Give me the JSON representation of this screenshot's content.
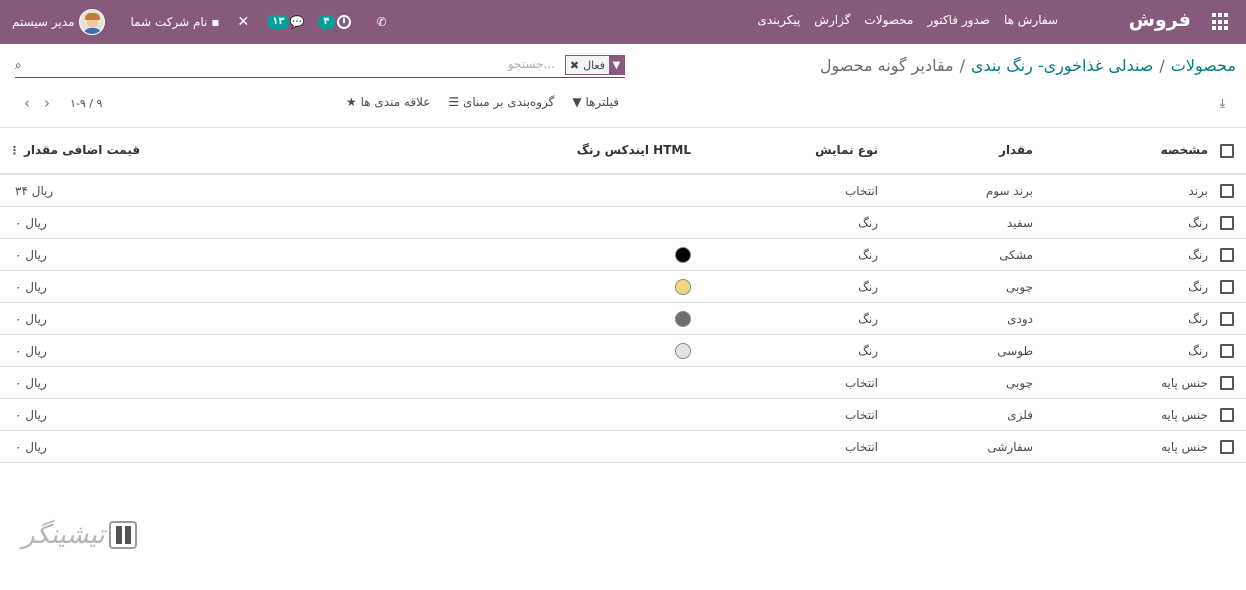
{
  "navbar": {
    "brand": "فروش",
    "menu": [
      "سفارش ها",
      "صدور فاکتور",
      "محصولات",
      "گزارش",
      "پیکربندی"
    ],
    "user": "مدیر سیستم",
    "company": "نام شرکت شما",
    "chat_badge": "۱۳",
    "activity_badge": "۴",
    "color": "#875a7b"
  },
  "breadcrumb": {
    "items": [
      "محصولات",
      "صندلی غذاخوری- رنگ بندی",
      "مقادیر گونه محصول"
    ],
    "sep": "/"
  },
  "search": {
    "placeholder": "جستجو...",
    "facet": "فعال"
  },
  "toolbar": {
    "filters": "فیلترها",
    "groupby": "گروه‌بندی بر مبنای",
    "favorites": "علاقه مندی ها",
    "pager": "۱-۹ / ۹"
  },
  "table": {
    "headers": {
      "attribute": "مشخصه",
      "value": "مقدار",
      "display": "نوع نمایش",
      "html_color": "ایندکس رنگ HTML",
      "extra_price": "قیمت اضافی مقدار"
    },
    "rows": [
      {
        "attribute": "برند",
        "value": "برند سوم",
        "display": "انتخاب",
        "color": "",
        "price": "۳۴ ریال"
      },
      {
        "attribute": "رنگ",
        "value": "سفید",
        "display": "رنگ",
        "color": "",
        "price": "۰ ریال"
      },
      {
        "attribute": "رنگ",
        "value": "مشکی",
        "display": "رنگ",
        "color": "#000000",
        "price": "۰ ریال"
      },
      {
        "attribute": "رنگ",
        "value": "چوبی",
        "display": "رنگ",
        "color": "#f0d77e",
        "price": "۰ ریال"
      },
      {
        "attribute": "رنگ",
        "value": "دودی",
        "display": "رنگ",
        "color": "#6e6e6e",
        "price": "۰ ریال"
      },
      {
        "attribute": "رنگ",
        "value": "طوسی",
        "display": "رنگ",
        "color": "#e4e4e4",
        "price": "۰ ریال"
      },
      {
        "attribute": "جنس پایه",
        "value": "چوبی",
        "display": "انتخاب",
        "color": "",
        "price": "۰ ریال"
      },
      {
        "attribute": "جنس پایه",
        "value": "فلزی",
        "display": "انتخاب",
        "color": "",
        "price": "۰ ریال"
      },
      {
        "attribute": "جنس پایه",
        "value": "سفارشی",
        "display": "انتخاب",
        "color": "",
        "price": "۰ ریال"
      }
    ]
  }
}
